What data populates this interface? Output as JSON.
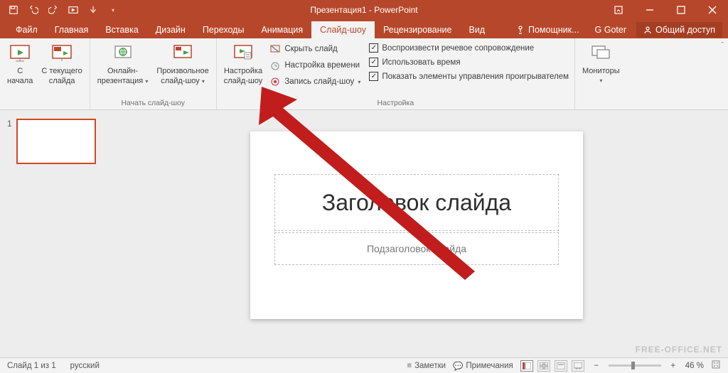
{
  "title": "Презентация1 - PowerPoint",
  "qat": {
    "save": "save-icon",
    "undo": "undo-icon",
    "redo": "redo-icon",
    "start": "start-from-beginning-icon",
    "touch": "touch-mode-icon"
  },
  "tabs": {
    "file": "Файл",
    "home": "Главная",
    "insert": "Вставка",
    "design": "Дизайн",
    "transitions": "Переходы",
    "animations": "Анимация",
    "slideshow": "Слайд-шоу",
    "review": "Рецензирование",
    "view": "Вид"
  },
  "topright": {
    "tellme": "Помощник...",
    "user": "G Goter",
    "share": "Общий доступ"
  },
  "ribbon": {
    "group_start": "Начать слайд-шоу",
    "from_begin_l1": "С",
    "from_begin_l2": "начала",
    "from_current_l1": "С текущего",
    "from_current_l2": "слайда",
    "online_l1": "Онлайн-",
    "online_l2": "презентация",
    "custom_l1": "Произвольное",
    "custom_l2": "слайд-шоу",
    "group_setup": "Настройка",
    "setup_l1": "Настройка",
    "setup_l2": "слайд-шоу",
    "hide": "Скрыть слайд",
    "rehearse": "Настройка времени",
    "record": "Запись слайд-шоу",
    "narr": "Воспроизвести речевое сопровождение",
    "timings": "Использовать время",
    "media": "Показать элементы управления проигрывателем",
    "group_monitors": "",
    "monitors": "Мониторы"
  },
  "slide": {
    "num": "1",
    "title_ph": "Заголовок слайда",
    "sub_ph": "Подзаголовок слайда"
  },
  "status": {
    "slideinfo": "Слайд 1 из 1",
    "lang": "русский",
    "notes": "Заметки",
    "comments": "Примечания",
    "zoom": "46 %",
    "fit": "fit-icon"
  },
  "watermark": "FREE-OFFICE.NET"
}
